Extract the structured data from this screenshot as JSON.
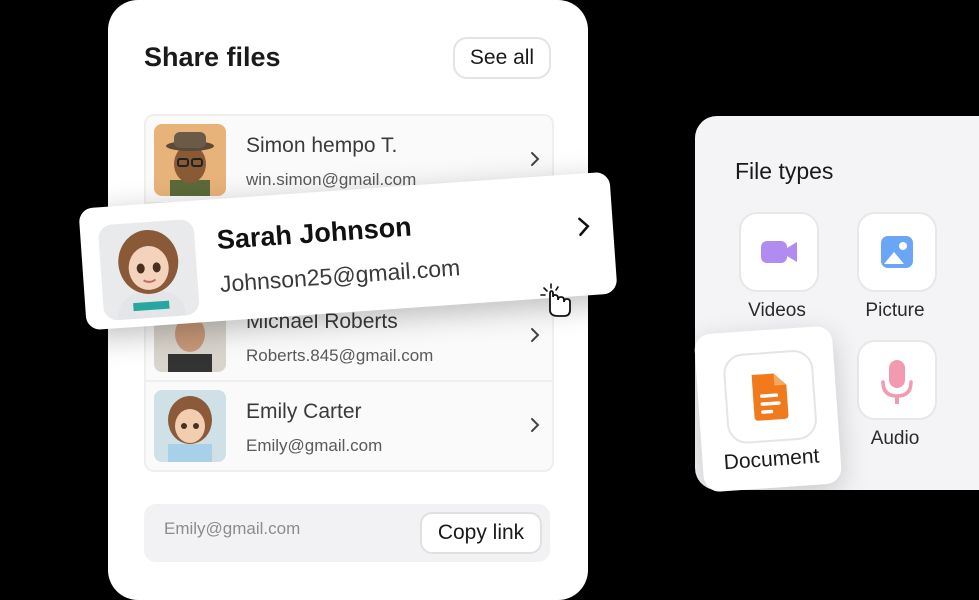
{
  "share": {
    "title": "Share files",
    "see_all_label": "See all",
    "contacts": [
      {
        "name": "Simon hempo T.",
        "email": "win.simon@gmail.com"
      },
      {
        "name": "Michael Roberts",
        "email": "Roberts.845@gmail.com"
      },
      {
        "name": "Emily Carter",
        "email": "Emily@gmail.com"
      }
    ],
    "link_field_value": "Emily@gmail.com",
    "copy_link_label": "Copy link"
  },
  "highlighted_contact": {
    "name": "Sarah Johnson",
    "email": "Johnson25@gmail.com"
  },
  "file_types": {
    "title": "File types",
    "items": [
      {
        "label": "Videos",
        "icon": "video-camera-icon",
        "color": "#b18cf0"
      },
      {
        "label": "Picture",
        "icon": "image-icon",
        "color": "#6aa6f5"
      },
      {
        "label": "Document",
        "icon": "document-icon",
        "color": "#f07a1c"
      },
      {
        "label": "Audio",
        "icon": "microphone-icon",
        "color": "#f29bb0"
      }
    ]
  }
}
